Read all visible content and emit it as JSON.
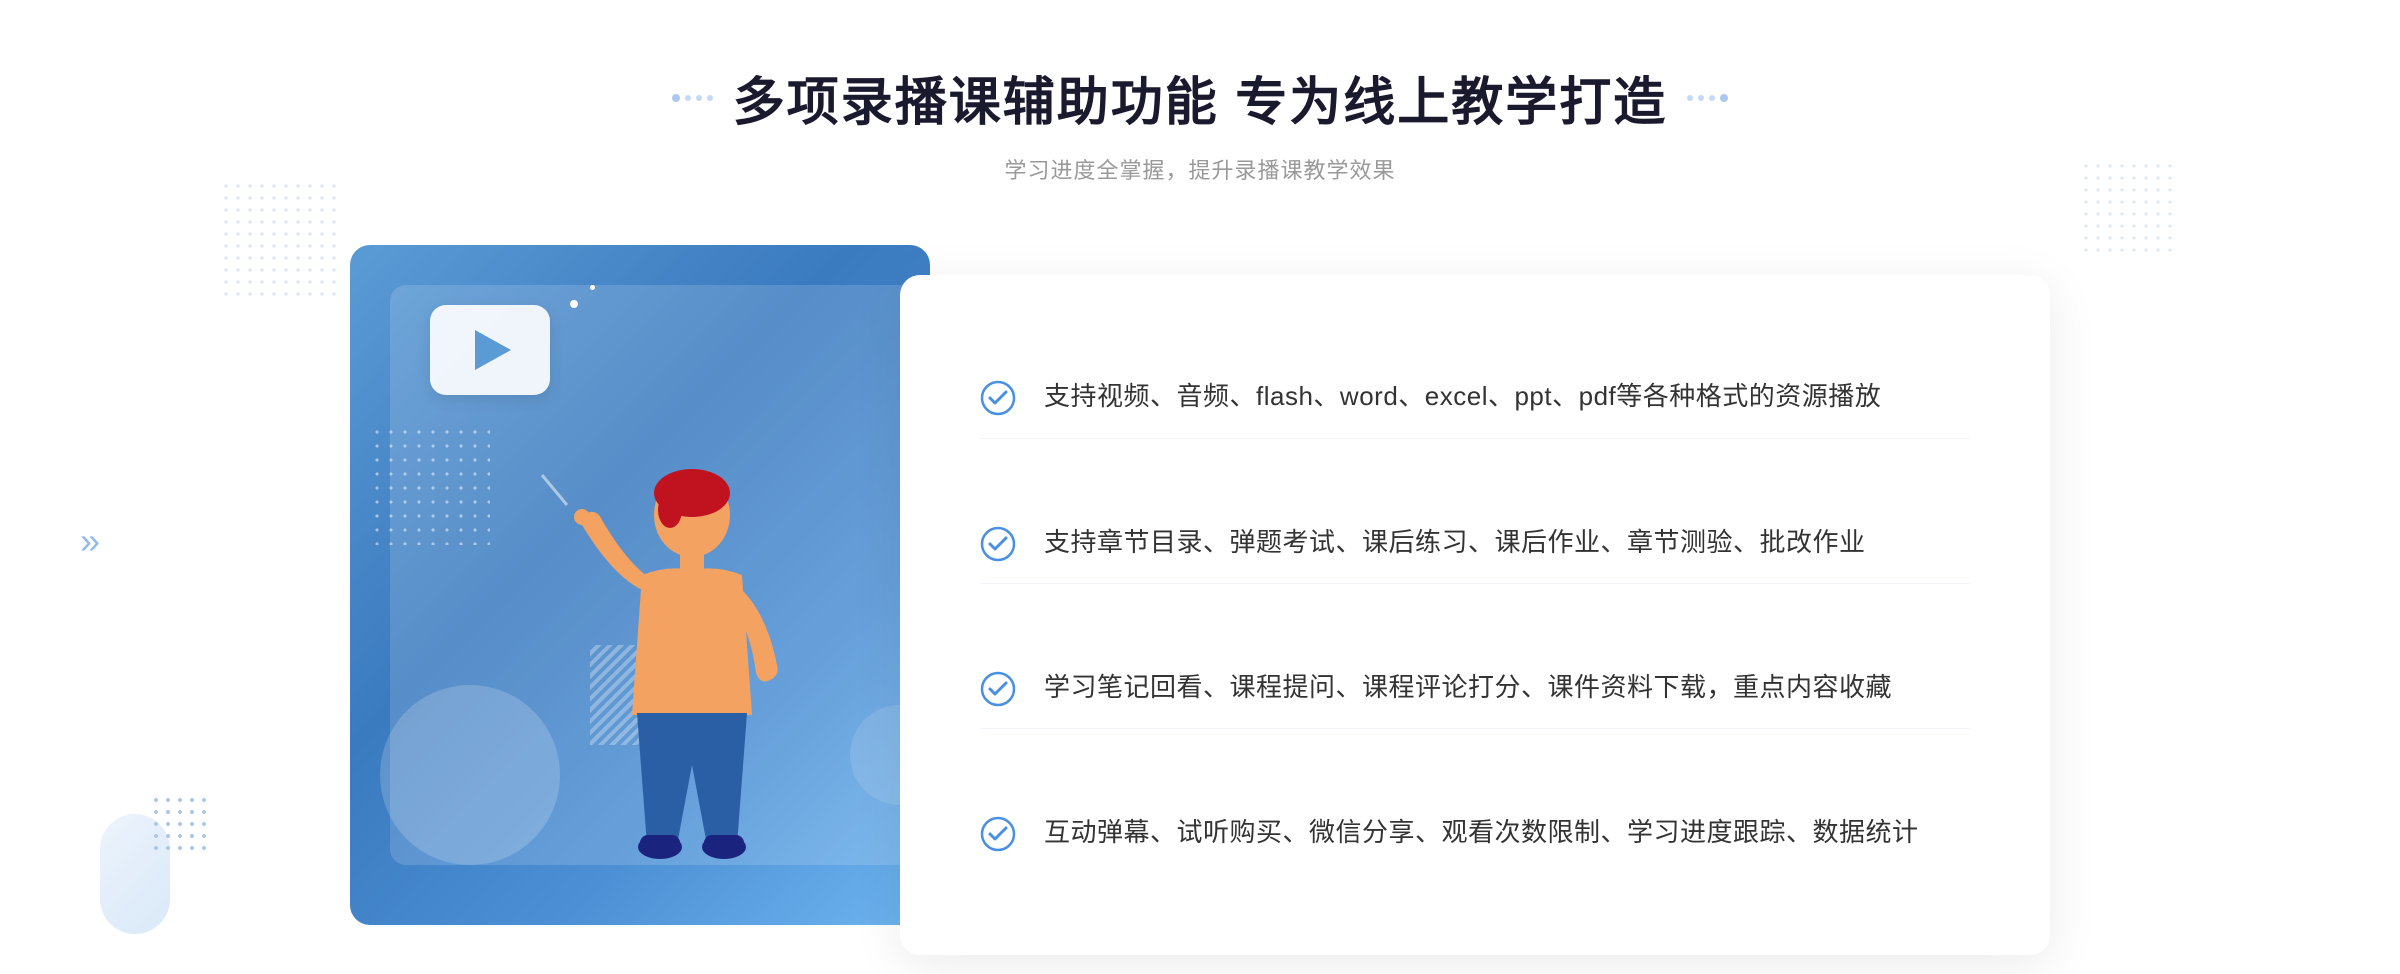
{
  "header": {
    "title": "多项录播课辅助功能 专为线上教学打造",
    "subtitle": "学习进度全掌握，提升录播课教学效果"
  },
  "features": [
    {
      "id": "feature-1",
      "text": "支持视频、音频、flash、word、excel、ppt、pdf等各种格式的资源播放"
    },
    {
      "id": "feature-2",
      "text": "支持章节目录、弹题考试、课后练习、课后作业、章节测验、批改作业"
    },
    {
      "id": "feature-3",
      "text": "学习笔记回看、课程提问、课程评论打分、课件资料下载，重点内容收藏"
    },
    {
      "id": "feature-4",
      "text": "互动弹幕、试听购买、微信分享、观看次数限制、学习进度跟踪、数据统计"
    }
  ],
  "decorators": {
    "left_dots": "···",
    "right_dots": "···",
    "arrow_left": "»"
  }
}
